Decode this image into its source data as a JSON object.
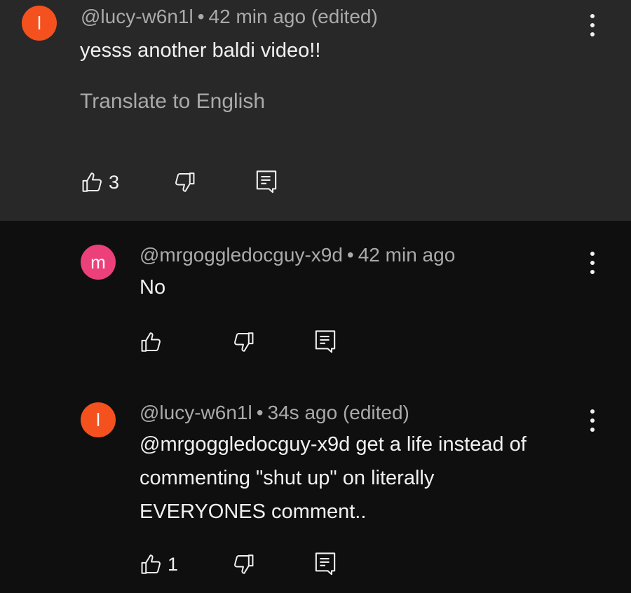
{
  "comments": [
    {
      "avatar_letter": "l",
      "avatar_color": "#f4511e",
      "author": "@lucy-w6n1l",
      "time": "42 min ago",
      "edited": "(edited)",
      "text": "yesss another baldi video!!",
      "translate": "Translate to English",
      "likes": "3"
    },
    {
      "avatar_letter": "m",
      "avatar_color": "#ec407a",
      "author": "@mrgoggledocguy-x9d",
      "time": "42 min ago",
      "text": "No"
    },
    {
      "avatar_letter": "l",
      "avatar_color": "#f4511e",
      "author": "@lucy-w6n1l",
      "time": "34s ago",
      "edited": "(edited)",
      "text_lines": [
        "@mrgoggledocguy-x9d get a life instead of",
        "commenting \"shut up\" on literally",
        "EVERYONES comment.."
      ],
      "likes": "1"
    }
  ],
  "separator": "•",
  "icons": {
    "like": "thumbs-up-icon",
    "dislike": "thumbs-down-icon",
    "reply": "reply-icon",
    "menu": "more-vert-icon"
  }
}
